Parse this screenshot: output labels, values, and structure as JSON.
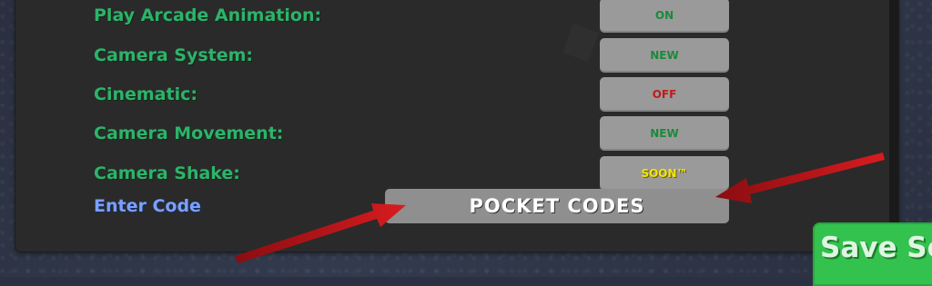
{
  "settings": {
    "rows": [
      {
        "label": "Play Arcade Animation:",
        "value": "ON"
      },
      {
        "label": "Camera System:",
        "value": "NEW"
      },
      {
        "label": "Cinematic:",
        "value": "OFF"
      },
      {
        "label": "Camera Movement:",
        "value": "NEW"
      },
      {
        "label": "Camera Shake:",
        "value": "SOON™"
      }
    ],
    "enter_code_label": "Enter Code",
    "code_button_label": "POCKET CODES"
  },
  "save_button": {
    "label": "Save Se"
  },
  "colors": {
    "label_green": "#2db36a",
    "label_blue": "#7aa0ff",
    "value_on": "#1a8a3a",
    "value_off": "#c21a1a",
    "value_soon": "#f2e600",
    "arrow_red": "#c8161b",
    "save_green": "#33c24d"
  },
  "icons": {
    "annotation": "red-arrow-icon"
  }
}
